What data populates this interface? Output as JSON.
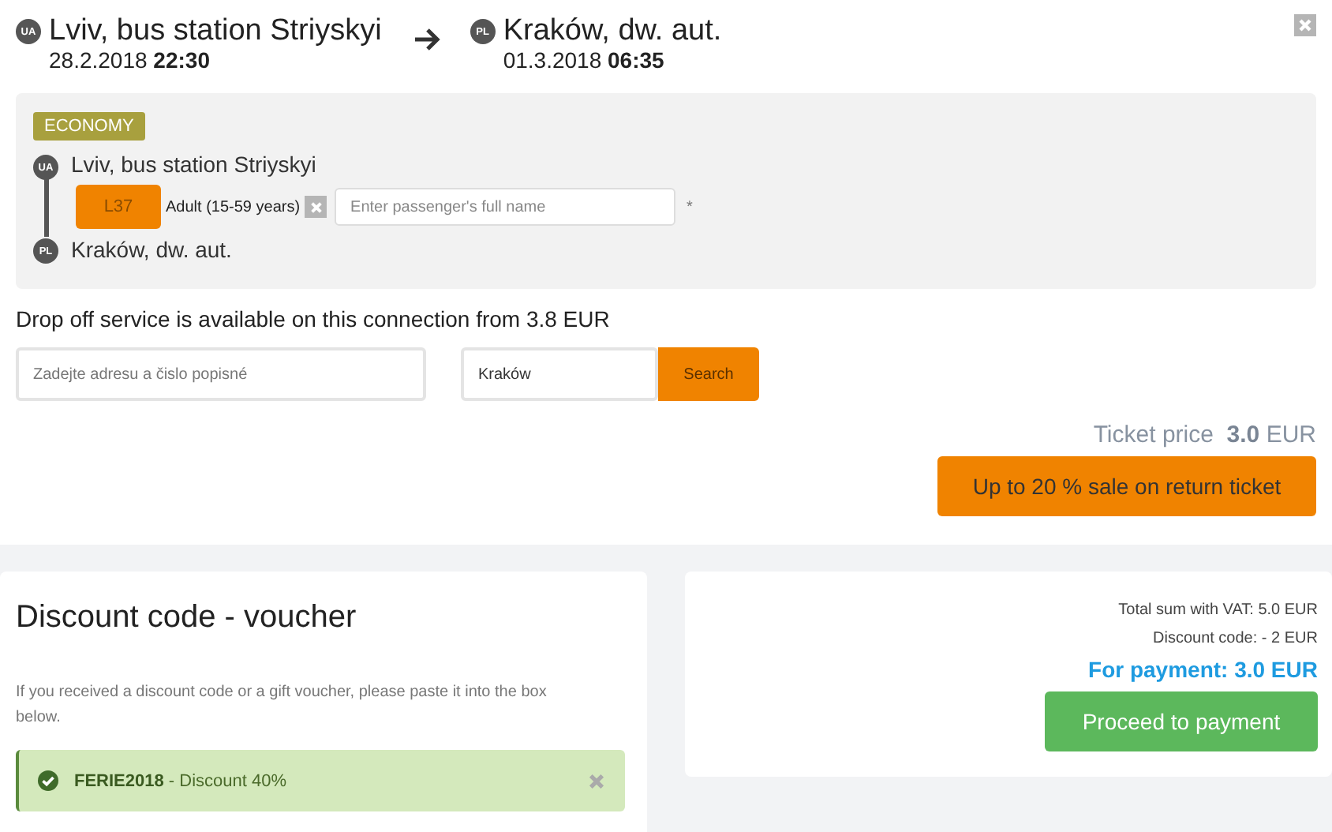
{
  "trip": {
    "departure": {
      "country": "UA",
      "place": "Lviv, bus station Striyskyi",
      "when": "28.2.2018 **22:30**"
    },
    "arrival": {
      "country": "PL",
      "place": "Kraków, dw. aut.",
      "when": "01.3.2018 **06:35**"
    }
  },
  "fare": {
    "class": "ECONOMY",
    "stops": [
      {
        "country": "UA",
        "name": "Lviv, bus station Striyskyi"
      },
      {
        "country": "PL",
        "name": "Kraków, dw. aut."
      }
    ],
    "passenger": {
      "seat": "L37",
      "category": "Adult (15-59 years)",
      "name_placeholder": "Enter passenger's full name",
      "required_mark": "*"
    }
  },
  "drop_off": {
    "text": "Drop off service is available on this connection from 3.8 EUR",
    "address_placeholder": "Zadejte adresu a čislo popisné",
    "city": "Kraków",
    "search": "Search"
  },
  "ticket_price": "Ticket price  **3.0** EUR",
  "return_offer": "Up to 20 % sale on return ticket",
  "voucher": {
    "title": "Discount code - voucher",
    "hint": "If you received a discount code or a gift voucher, please paste it into the box below.",
    "applied": "**FERIE2018** - Discount 40%"
  },
  "summary": {
    "lines": [
      "Total sum with VAT: 5.0 EUR",
      "Discount code: - 2 EUR"
    ],
    "total": "For payment: 3.0 EUR",
    "button": "Proceed to payment"
  }
}
